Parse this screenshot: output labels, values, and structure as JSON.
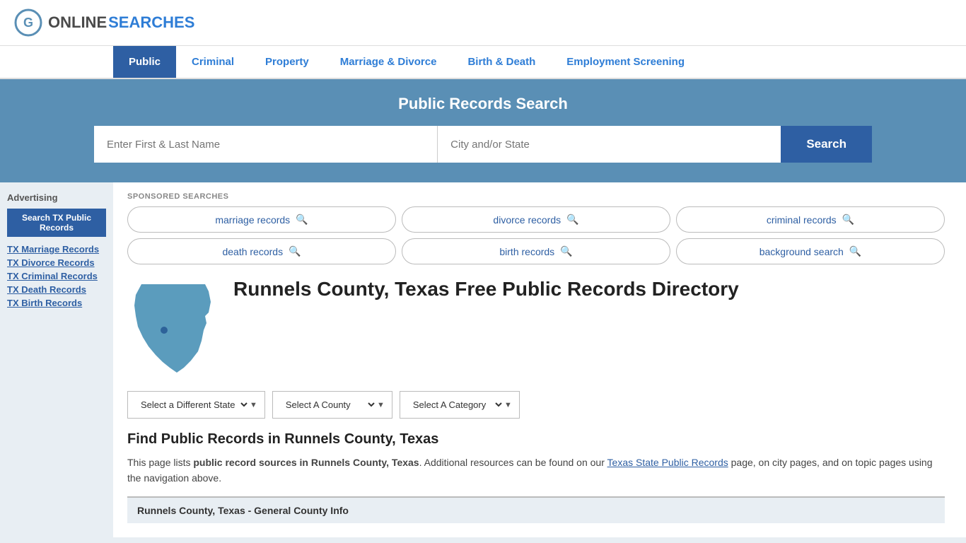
{
  "header": {
    "logo_online": "ONLINE",
    "logo_searches": "SEARCHES"
  },
  "nav": {
    "items": [
      {
        "label": "Public",
        "active": true
      },
      {
        "label": "Criminal",
        "active": false
      },
      {
        "label": "Property",
        "active": false
      },
      {
        "label": "Marriage & Divorce",
        "active": false
      },
      {
        "label": "Birth & Death",
        "active": false
      },
      {
        "label": "Employment Screening",
        "active": false
      }
    ]
  },
  "search_banner": {
    "title": "Public Records Search",
    "name_placeholder": "Enter First & Last Name",
    "location_placeholder": "City and/or State",
    "button_label": "Search"
  },
  "sponsored": {
    "label": "SPONSORED SEARCHES",
    "pills": [
      "marriage records",
      "divorce records",
      "criminal records",
      "death records",
      "birth records",
      "background search"
    ]
  },
  "county": {
    "title": "Runnels County, Texas Free Public Records Directory"
  },
  "dropdowns": {
    "state_label": "Select a Different State",
    "county_label": "Select A County",
    "category_label": "Select A Category"
  },
  "find_records": {
    "title": "Find Public Records in Runnels County, Texas",
    "text_part1": "This page lists ",
    "bold_text": "public record sources in Runnels County, Texas",
    "text_part2": ". Additional resources can be found on our ",
    "link_text": "Texas State Public Records",
    "text_part3": " page, on city pages, and on topic pages using the navigation above."
  },
  "general_info": {
    "label": "Runnels County, Texas - General County Info"
  },
  "sidebar": {
    "advertising_label": "Advertising",
    "ad_button_label": "Search TX Public Records",
    "links": [
      "TX Marriage Records",
      "TX Divorce Records",
      "TX Criminal Records",
      "TX Death Records",
      "TX Birth Records"
    ]
  }
}
